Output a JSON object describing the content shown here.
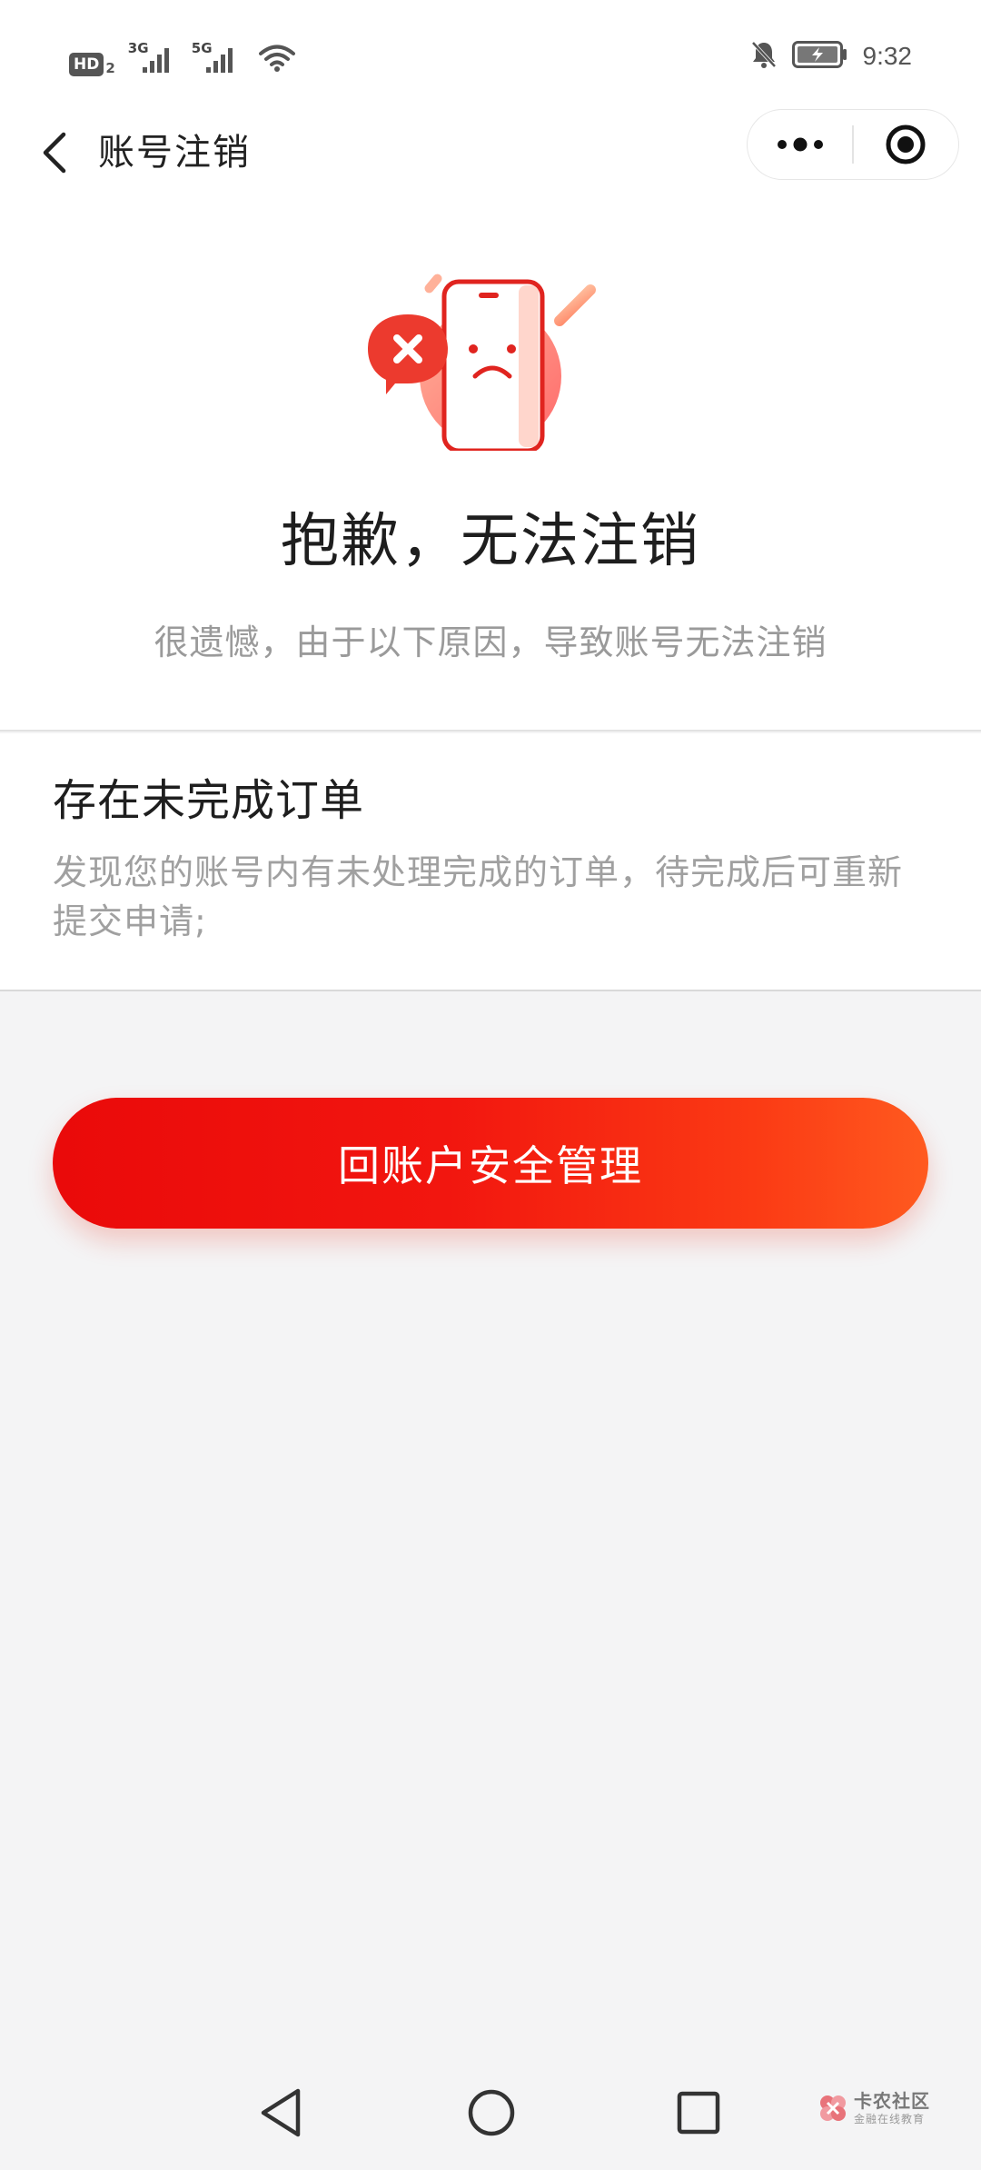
{
  "status_bar": {
    "hd_label": "HD",
    "hd_sub": "2",
    "sim1_gen": "3G",
    "sim2_gen": "5G",
    "time": "9:32",
    "icons": [
      "hd-icon",
      "signal-icon",
      "signal-icon",
      "wifi-icon",
      "mute-bell-icon",
      "battery-charging-icon"
    ]
  },
  "nav": {
    "title": "账号注销",
    "back_icon": "chevron-left-icon",
    "more_icon": "more-dots-icon",
    "close_icon": "target-close-icon"
  },
  "main": {
    "illustration_icon": "sad-phone-error-icon",
    "headline": "抱歉，无法注销",
    "subline": "很遗憾，由于以下原因，导致账号无法注销"
  },
  "reason": {
    "title": "存在未完成订单",
    "description": "发现您的账号内有未处理完成的订单，待完成后可重新提交申请;"
  },
  "action": {
    "button_label": "回账户安全管理"
  },
  "system_nav": {
    "icons": [
      "back-triangle-icon",
      "home-circle-icon",
      "recent-square-icon"
    ]
  },
  "watermark": {
    "main": "卡农社区",
    "sub": "金融在线教育"
  },
  "colors": {
    "accent_start": "#ea0a0a",
    "accent_end": "#ff5a1f",
    "page_bg": "#f4f4f5"
  }
}
